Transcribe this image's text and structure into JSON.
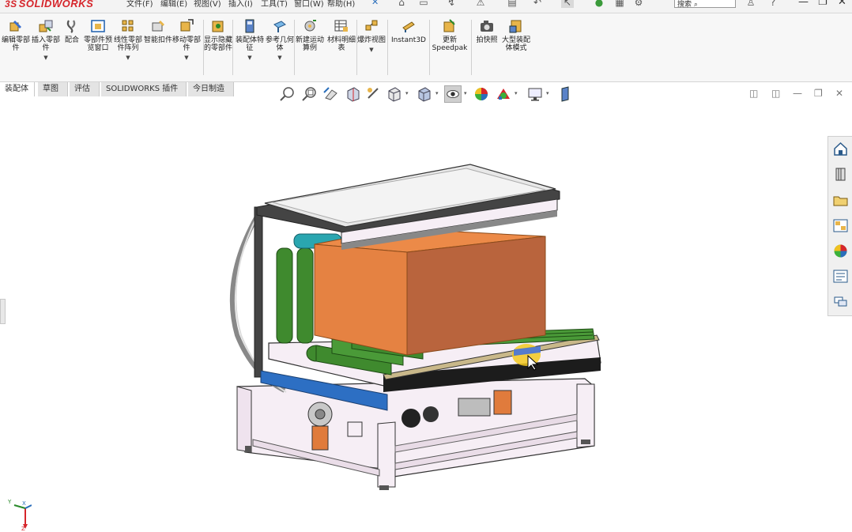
{
  "app": {
    "logo_text": "SOLIDWORKS",
    "logo_mark": "3S"
  },
  "menubar": {
    "items": [
      "文件(F)",
      "编辑(E)",
      "视图(V)",
      "插入(I)",
      "工具(T)",
      "窗口(W)",
      "帮助(H)"
    ],
    "pin": "✕",
    "search_placeholder": "搜索",
    "help_symbol": "?"
  },
  "ribbon": {
    "buttons": [
      {
        "label": "编辑零部件",
        "icon": "edit-component-icon"
      },
      {
        "label": "插入零部件",
        "icon": "insert-component-icon",
        "dropdown": true
      },
      {
        "label": "配合",
        "icon": "mate-icon"
      },
      {
        "label": "零部件预览窗口",
        "icon": "component-preview-icon"
      },
      {
        "label": "线性零部件阵列",
        "icon": "linear-pattern-icon",
        "dropdown": true
      },
      {
        "label": "智能扣件",
        "icon": "smart-fasteners-icon"
      },
      {
        "label": "移动零部件",
        "icon": "move-component-icon",
        "dropdown": true
      },
      {
        "label": "显示隐藏的零部件",
        "icon": "show-hidden-icon"
      },
      {
        "label": "装配体特征",
        "icon": "assembly-features-icon",
        "dropdown": true
      },
      {
        "label": "参考几何体",
        "icon": "reference-geometry-icon",
        "dropdown": true
      },
      {
        "label": "新建运动算例",
        "icon": "new-motion-study-icon"
      },
      {
        "label": "材料明细表",
        "icon": "bill-of-materials-icon"
      },
      {
        "label": "爆炸视图",
        "icon": "exploded-view-icon",
        "dropdown": true
      },
      {
        "label": "Instant3D",
        "icon": "instant3d-icon"
      },
      {
        "label": "更新Speedpak",
        "icon": "update-speedpak-icon"
      },
      {
        "label": "拍快照",
        "icon": "take-snapshot-icon"
      },
      {
        "label": "大型装配体模式",
        "icon": "large-assembly-icon"
      }
    ]
  },
  "tabs": [
    {
      "label": "装配体",
      "active": true
    },
    {
      "label": "草图",
      "active": false
    },
    {
      "label": "评估",
      "active": false
    },
    {
      "label": "SOLIDWORKS 插件",
      "active": false
    },
    {
      "label": "今日制造",
      "active": false
    }
  ],
  "hud": {
    "buttons": [
      "zoom-to-fit-icon",
      "zoom-to-area-icon",
      "previous-view-icon",
      "section-view-icon",
      "dynamic-annotation-icon",
      "view-orientation-icon",
      "display-style-icon",
      "hide-show-items-icon",
      "edit-appearance-icon",
      "apply-scene-icon",
      "view-settings-icon",
      "display-pane-icon"
    ]
  },
  "taskpane": {
    "buttons": [
      "solidworks-resources-icon",
      "design-library-icon",
      "file-explorer-icon",
      "view-palette-icon",
      "appearances-icon",
      "custom-properties-icon",
      "forum-icon"
    ]
  },
  "triad": {
    "labels": [
      "Y",
      "X",
      "Z"
    ]
  },
  "colors": {
    "accent": "#d6252b",
    "box": "#e07b3c",
    "rollers": "#3f8a2e",
    "frame": "#f4eaf2",
    "blue_bar": "#2d6fc3",
    "teal_roller": "#2aa6b0"
  }
}
